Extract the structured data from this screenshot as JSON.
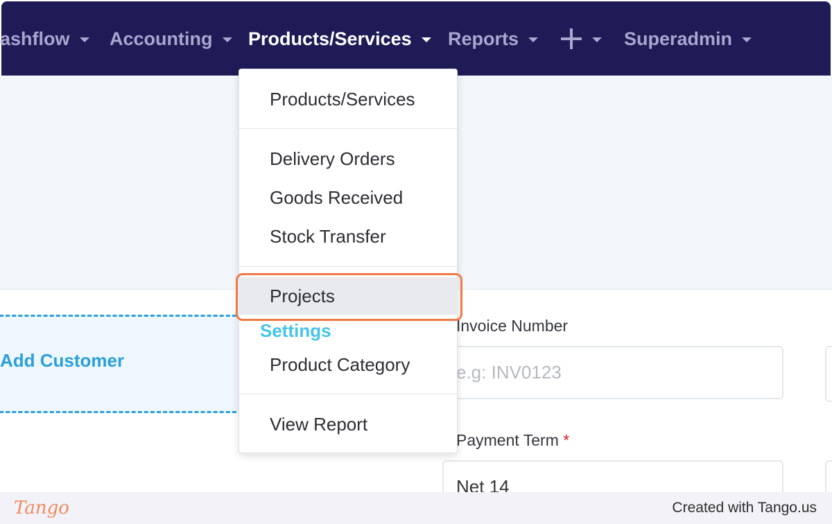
{
  "navbar": {
    "items": [
      {
        "label": "ashflow"
      },
      {
        "label": "Accounting"
      },
      {
        "label": "Products/Services"
      },
      {
        "label": "Reports"
      },
      {
        "label": "Superadmin"
      }
    ],
    "active": "Products/Services",
    "create_icon": "plus-icon"
  },
  "customer": {
    "add_label": "Add Customer"
  },
  "form": {
    "invoice_number_label": "Invoice Number",
    "invoice_number_placeholder": "e.g: INV0123",
    "invoice_number_value": "",
    "payment_term_label": "Payment Term",
    "payment_term_required": "*",
    "payment_term_value": "Net 14"
  },
  "dropdown": {
    "items": [
      {
        "label": "Products/Services"
      },
      {
        "label": "Delivery Orders"
      },
      {
        "label": "Goods Received"
      },
      {
        "label": "Stock Transfer"
      },
      {
        "label": "Projects"
      },
      {
        "label": "Product Category"
      },
      {
        "label": "View Report"
      }
    ],
    "section_header": "Settings",
    "highlighted": "Projects"
  },
  "footer": {
    "logo": "Tango",
    "credit": "Created with Tango.us"
  },
  "colors": {
    "navbar_bg": "#1e1b56",
    "nav_inactive": "#a9a7cf",
    "nav_active": "#ffffff",
    "link_blue": "#2a9fd8",
    "settings_cyan": "#45c4e8",
    "focus_orange": "#f07a45"
  }
}
